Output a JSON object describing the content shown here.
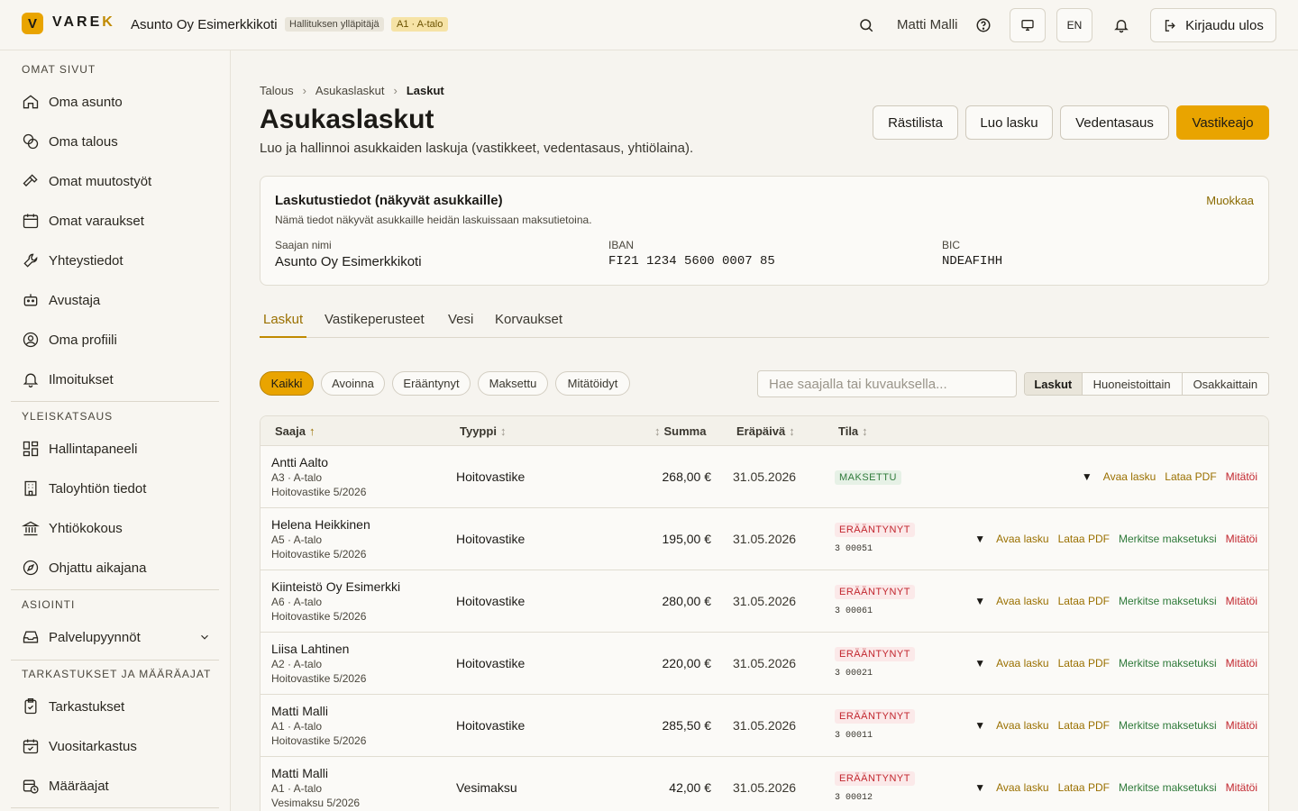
{
  "header": {
    "logo_text_a": "VARE",
    "logo_text_b": "K",
    "logo_letter": "V",
    "org_name": "Asunto Oy Esimerkkikoti",
    "role_badge": "Hallituksen ylläpitäjä",
    "apartment_badge": "A1 · A-talo",
    "user_name": "Matti Malli",
    "language": "EN",
    "logout_label": "Kirjaudu ulos"
  },
  "sidebar": {
    "section_own": "OMAT SIVUT",
    "own_items": [
      {
        "label": "Oma asunto",
        "icon": "home-icon"
      },
      {
        "label": "Oma talous",
        "icon": "coins-icon"
      },
      {
        "label": "Omat muutostyöt",
        "icon": "hammer-icon"
      },
      {
        "label": "Omat varaukset",
        "icon": "calendar-icon"
      },
      {
        "label": "Yhteystiedot",
        "icon": "wrench-icon"
      },
      {
        "label": "Avustaja",
        "icon": "bot-icon"
      },
      {
        "label": "Oma profiili",
        "icon": "user-circle-icon"
      },
      {
        "label": "Ilmoitukset",
        "icon": "bell-icon"
      }
    ],
    "section_overview": "YLEISKATSAUS",
    "overview_items": [
      {
        "label": "Hallintapaneeli",
        "icon": "dashboard-icon"
      },
      {
        "label": "Taloyhtiön tiedot",
        "icon": "building-icon"
      },
      {
        "label": "Yhtiökokous",
        "icon": "landmark-icon"
      },
      {
        "label": "Ohjattu aikajana",
        "icon": "compass-icon"
      }
    ],
    "section_service": "ASIOINTI",
    "service_items": [
      {
        "label": "Palvelupyynnöt",
        "icon": "inbox-icon"
      }
    ],
    "section_inspections": "TARKASTUKSET JA MÄÄRÄAJAT",
    "inspection_items": [
      {
        "label": "Tarkastukset",
        "icon": "clipboard-check-icon"
      },
      {
        "label": "Vuositarkastus",
        "icon": "calendar-check-icon"
      },
      {
        "label": "Määräajat",
        "icon": "calendar-clock-icon"
      }
    ]
  },
  "breadcrumb": [
    "Talous",
    "Asukaslaskut",
    "Laskut"
  ],
  "page": {
    "title": "Asukaslaskut",
    "subtitle": "Luo ja hallinnoi asukkaiden laskuja (vastikkeet, vedentasaus, yhtiölaina)."
  },
  "toolbar": {
    "rastilista": "Rästilista",
    "luo_lasku": "Luo lasku",
    "vedentasaus": "Vedentasaus",
    "vastikeajo": "Vastikeajo"
  },
  "billing_card": {
    "title": "Laskutustiedot (näkyvät asukkaille)",
    "subtitle": "Nämä tiedot näkyvät asukkaille heidän laskuissaan maksutietoina.",
    "edit_label": "Muokkaa",
    "recipient_label": "Saajan nimi",
    "recipient_value": "Asunto Oy Esimerkkikoti",
    "iban_label": "IBAN",
    "iban_value": "FI21 1234 5600 0007 85",
    "bic_label": "BIC",
    "bic_value": "NDEAFIHH"
  },
  "tabs": [
    "Laskut",
    "Vastikeperusteet",
    "Vesi",
    "Korvaukset"
  ],
  "filters": [
    "Kaikki",
    "Avoinna",
    "Erääntynyt",
    "Maksettu",
    "Mitätöidyt"
  ],
  "search": {
    "placeholder": "Hae saajalla tai kuvauksella..."
  },
  "view_toggle": [
    "Laskut",
    "Huoneistoittain",
    "Osakkaittain"
  ],
  "table": {
    "columns": {
      "saaja": "Saaja",
      "tyyppi": "Tyyppi",
      "summa": "Summa",
      "erapaiva": "Eräpäivä",
      "tila": "Tila"
    },
    "actions": {
      "open": "Avaa lasku",
      "pdf": "Lataa PDF",
      "mark_paid": "Merkitse maksetuksi",
      "void": "Mitätöi",
      "expand": "▼"
    },
    "rows": [
      {
        "name": "Antti Aalto",
        "apartment": "A3 · A-talo",
        "description": "Hoitovastike 5/2026",
        "type": "Hoitovastike",
        "amount": "268,00 €",
        "due": "31.05.2026",
        "status": "MAKSETTU",
        "ref": ""
      },
      {
        "name": "Helena Heikkinen",
        "apartment": "A5 · A-talo",
        "description": "Hoitovastike 5/2026",
        "type": "Hoitovastike",
        "amount": "195,00 €",
        "due": "31.05.2026",
        "status": "ERÄÄNTYNYT",
        "ref": "3 00051"
      },
      {
        "name": "Kiinteistö Oy Esimerkki",
        "apartment": "A6 · A-talo",
        "description": "Hoitovastike 5/2026",
        "type": "Hoitovastike",
        "amount": "280,00 €",
        "due": "31.05.2026",
        "status": "ERÄÄNTYNYT",
        "ref": "3 00061"
      },
      {
        "name": "Liisa Lahtinen",
        "apartment": "A2 · A-talo",
        "description": "Hoitovastike 5/2026",
        "type": "Hoitovastike",
        "amount": "220,00 €",
        "due": "31.05.2026",
        "status": "ERÄÄNTYNYT",
        "ref": "3 00021"
      },
      {
        "name": "Matti Malli",
        "apartment": "A1 · A-talo",
        "description": "Hoitovastike 5/2026",
        "type": "Hoitovastike",
        "amount": "285,50 €",
        "due": "31.05.2026",
        "status": "ERÄÄNTYNYT",
        "ref": "3 00011"
      },
      {
        "name": "Matti Malli",
        "apartment": "A1 · A-talo",
        "description": "Vesimaksu 5/2026",
        "type": "Vesimaksu",
        "amount": "42,00 €",
        "due": "31.05.2026",
        "status": "ERÄÄNTYNYT",
        "ref": "3 00012"
      }
    ]
  },
  "colors": {
    "accent": "#e9a400",
    "paid": "#2f7a3a",
    "overdue": "#c2262e"
  }
}
